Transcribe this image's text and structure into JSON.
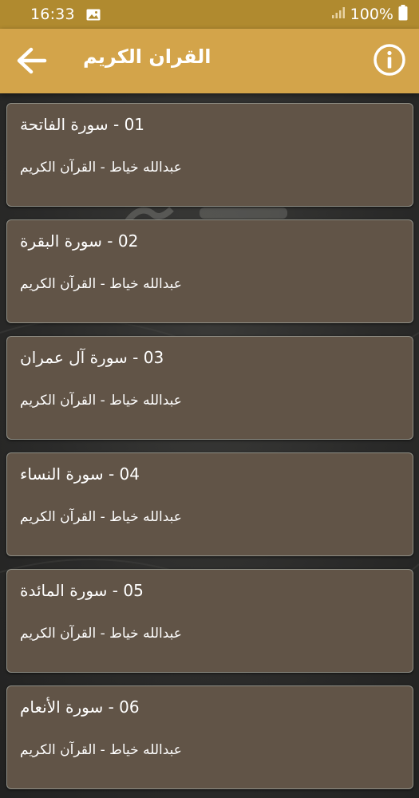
{
  "status_bar": {
    "time": "16:33",
    "battery": "100%"
  },
  "app_bar": {
    "title": "القران الكريم"
  },
  "surahs": [
    {
      "title": "01 - سورة الفاتحة",
      "subtitle": "عبدالله خياط - القرآن الكريم"
    },
    {
      "title": "02 - سورة البقرة",
      "subtitle": "عبدالله خياط - القرآن الكريم"
    },
    {
      "title": "03 - سورة آل عمران",
      "subtitle": "عبدالله خياط - القرآن الكريم"
    },
    {
      "title": "04 - سورة النساء",
      "subtitle": "عبدالله خياط - القرآن الكريم"
    },
    {
      "title": "05 - سورة المائدة",
      "subtitle": "عبدالله خياط - القرآن الكريم"
    },
    {
      "title": "06 - سورة الأنعام",
      "subtitle": "عبدالله خياط - القرآن الكريم"
    }
  ],
  "icons": {
    "back": "arrow-back-icon",
    "info": "info-icon",
    "gallery": "image-icon",
    "signal": "signal-icon",
    "battery": "battery-icon"
  },
  "colors": {
    "status_bar": "#b08a2f",
    "app_bar": "#d3a44a",
    "card": "#615447",
    "card_border": "#8f8f86",
    "text": "#ffffff"
  }
}
